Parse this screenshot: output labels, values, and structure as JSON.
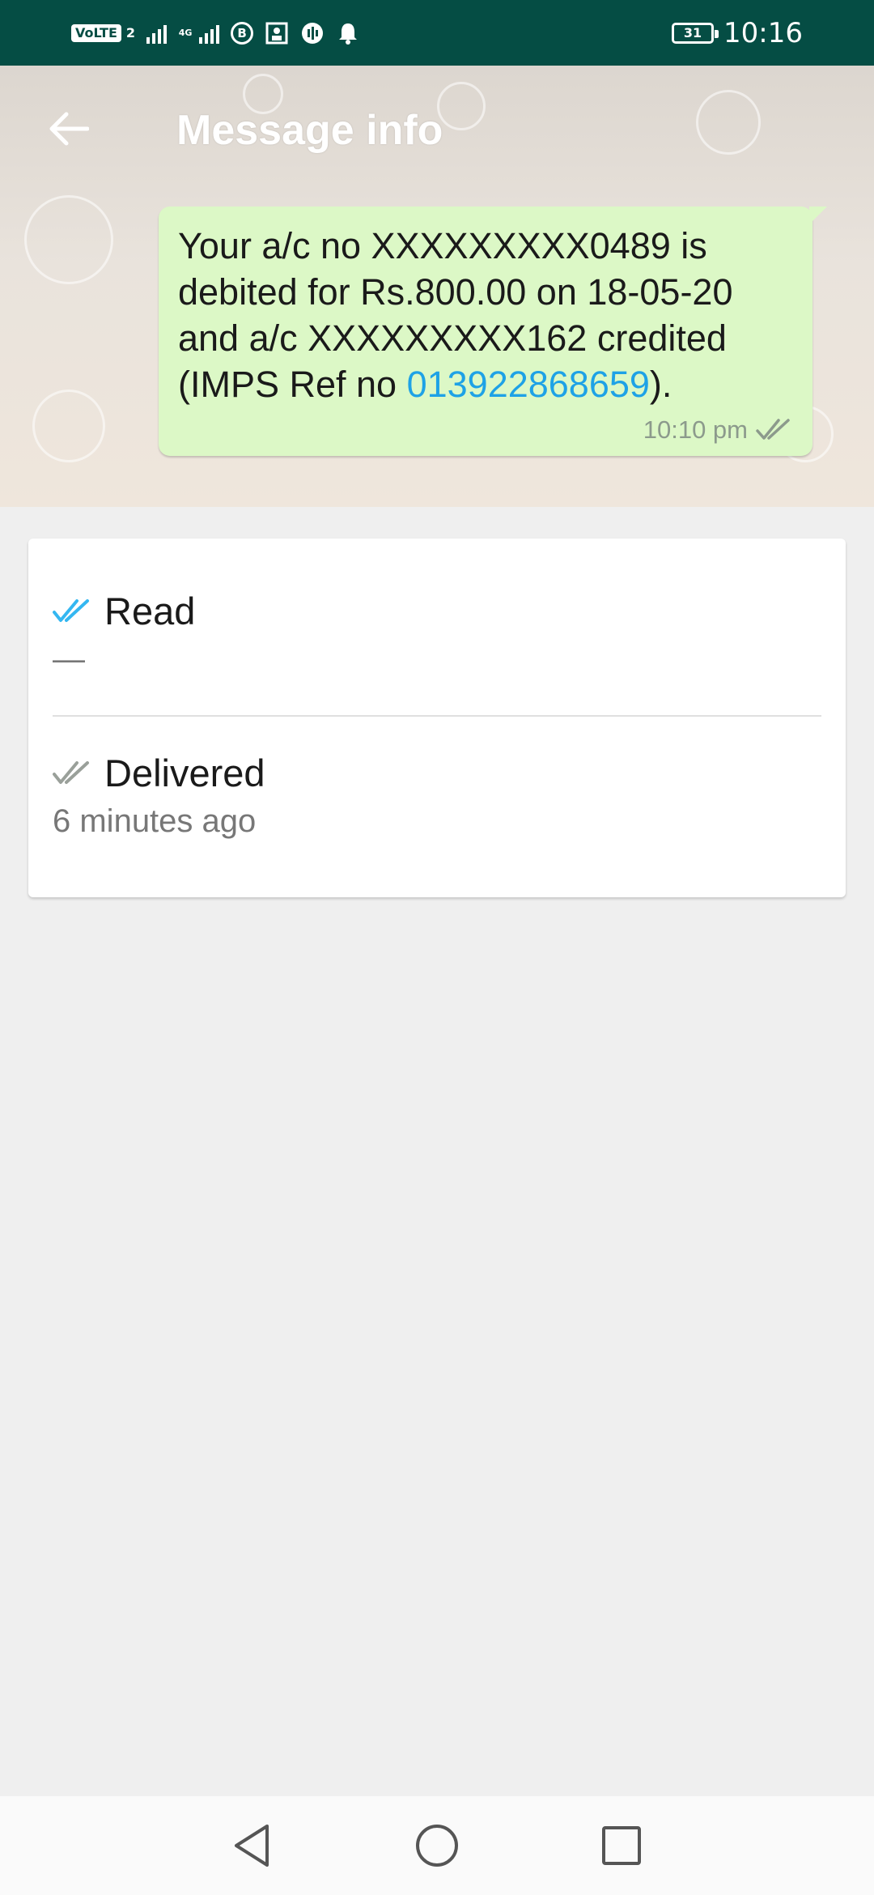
{
  "status_bar": {
    "volte": "VoLTE",
    "sim": "2",
    "network": "4G",
    "battery": "31",
    "time": "10:16",
    "icons": [
      "volte-icon",
      "signal-icon",
      "signal-4g-icon",
      "b-icon",
      "app-icon",
      "sound-icon",
      "notification-bell-icon",
      "battery-icon"
    ]
  },
  "header": {
    "title": "Message info",
    "back_icon": "back-arrow-icon"
  },
  "message": {
    "text": "Your a/c no XXXXXXXXX0489 is debited for Rs.800.00 on 18-05-20 and a/c XXXXXXXXX162 credited (IMPS Ref no ",
    "link": "013922868659",
    "text_end": ").",
    "time": "10:10 pm",
    "status_icon": "double-check-icon"
  },
  "info": {
    "read": {
      "label": "Read",
      "value": "—",
      "icon": "double-check-blue-icon"
    },
    "delivered": {
      "label": "Delivered",
      "value": "6 minutes ago",
      "icon": "double-check-gray-icon"
    }
  },
  "colors": {
    "status_bar": "#054d44",
    "bubble": "#dcf8c6",
    "read_check": "#34b7f1",
    "gray_check": "#8c9a8c",
    "link": "#1ea2e6",
    "background": "#efefef"
  },
  "nav": {
    "icons": [
      "nav-back-icon",
      "nav-home-icon",
      "nav-recents-icon"
    ]
  }
}
